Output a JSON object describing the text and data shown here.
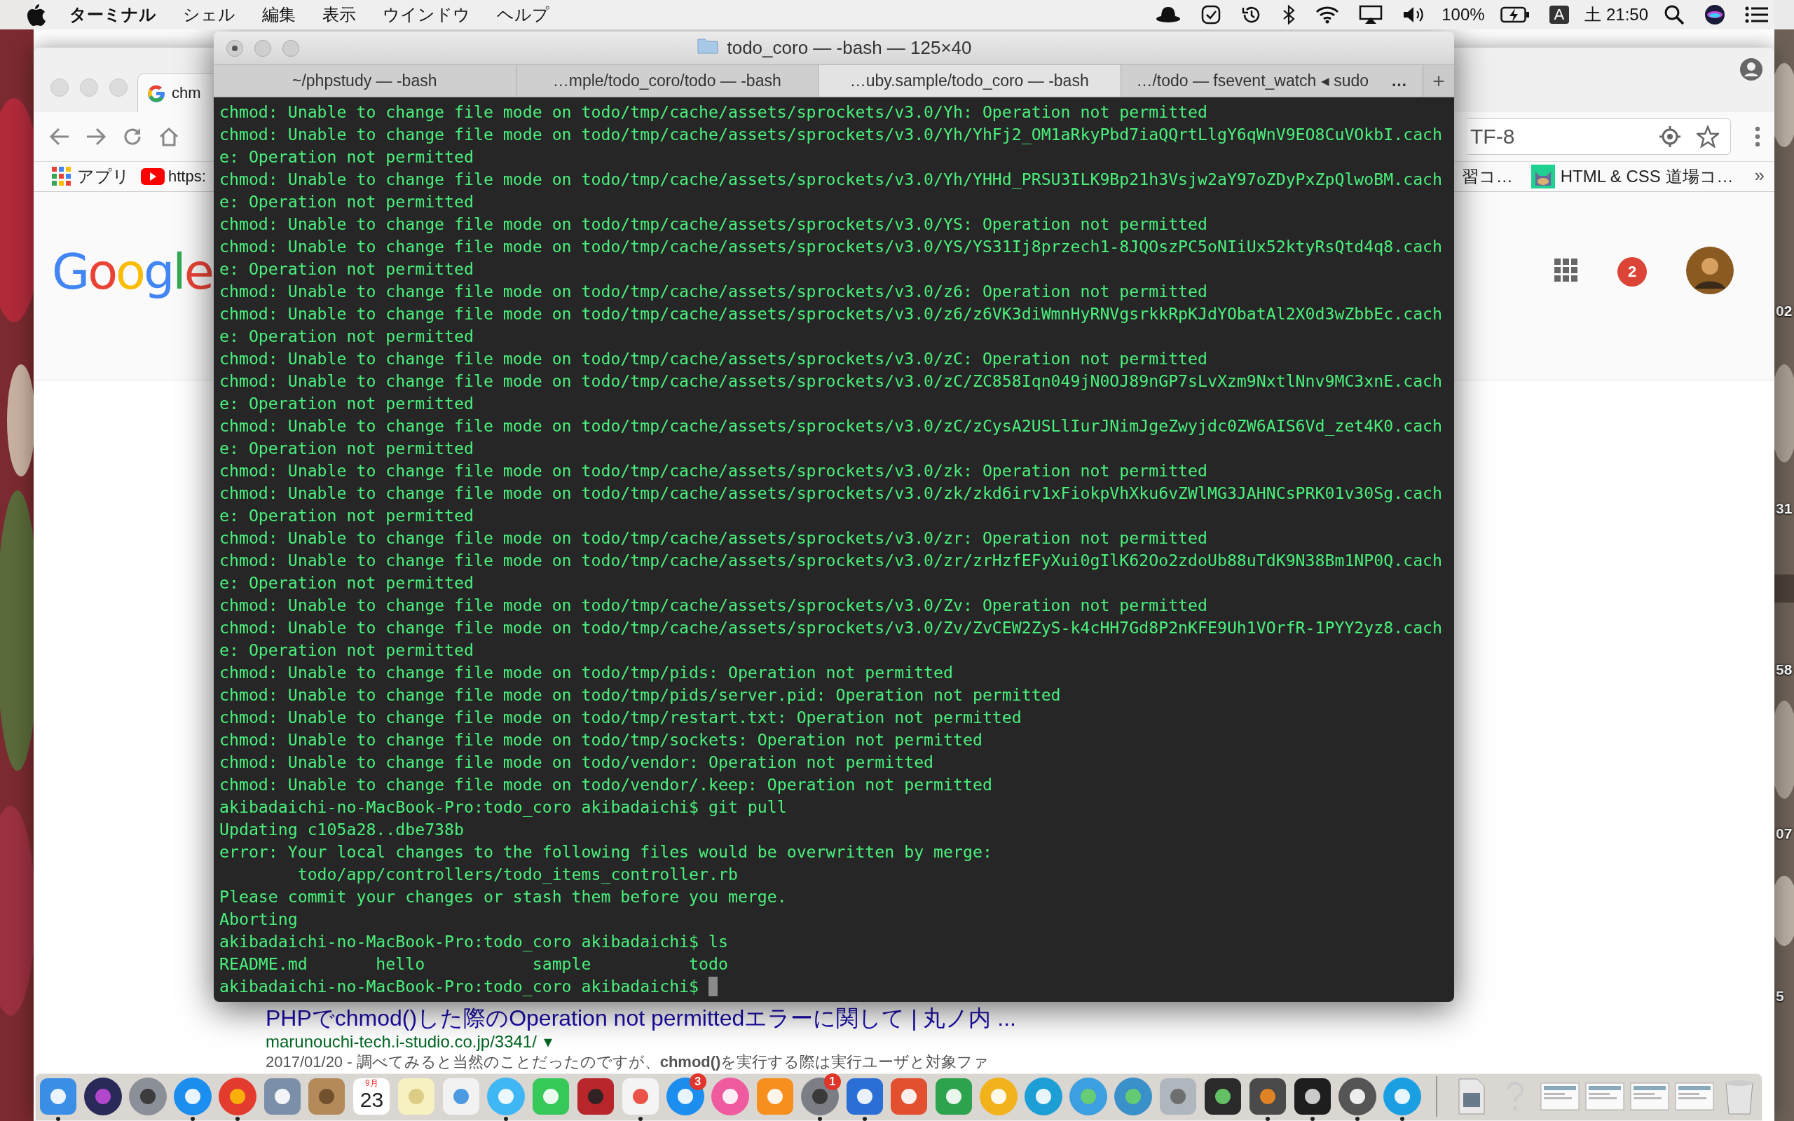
{
  "menu_bar": {
    "app_name": "ターミナル",
    "menus": [
      "シェル",
      "編集",
      "表示",
      "ウインドウ",
      "ヘルプ"
    ],
    "battery": "100%",
    "input_source": "A",
    "clock": "土 21:50"
  },
  "browser": {
    "tabs": [
      {
        "title": "chm",
        "selected": true
      }
    ],
    "address": "TF-8",
    "bookmarks_left": [
      {
        "label": "アプリ",
        "kind": "apps"
      },
      {
        "label": "https:",
        "kind": "video"
      }
    ],
    "bookmarks_right": [
      {
        "label": "習コ…",
        "kind": "plain"
      },
      {
        "label": "HTML & CSS 道場コ…",
        "kind": "cat"
      }
    ],
    "bookmarks_more": "»",
    "logo": "Google",
    "notification_count": "2",
    "result": {
      "title": "PHPでchmod()した際のOperation not permittedエラーに関して | 丸ノ内 ...",
      "url": "marunouchi-tech.i-studio.co.jp/3341/",
      "url_caret": "▾",
      "snippet": "2017/01/20 - 調べてみると当然のことだったのですが、**chmod()**を実行する際は実行ユーザと対象ファ"
    }
  },
  "terminal": {
    "title": "todo_coro — -bash — 125×40",
    "tabs": [
      {
        "label": "~/phpstudy — -bash",
        "selected": false
      },
      {
        "label": "…mple/todo_coro/todo — -bash",
        "selected": false
      },
      {
        "label": "…uby.sample/todo_coro — -bash",
        "selected": true
      },
      {
        "label": "…/todo — fsevent_watch ◂ sudo",
        "selected": false
      }
    ],
    "tabs_overflow": "…",
    "new_tab": "+",
    "lines": [
      "chmod: Unable to change file mode on todo/tmp/cache/assets/sprockets/v3.0/Yh: Operation not permitted",
      "chmod: Unable to change file mode on todo/tmp/cache/assets/sprockets/v3.0/Yh/YhFj2_OM1aRkyPbd7iaQQrtLlgY6qWnV9EO8CuVOkbI.cach",
      "e: Operation not permitted",
      "chmod: Unable to change file mode on todo/tmp/cache/assets/sprockets/v3.0/Yh/YHHd_PRSU3ILK9Bp21h3Vsjw2aY97oZDyPxZpQlwoBM.cach",
      "e: Operation not permitted",
      "chmod: Unable to change file mode on todo/tmp/cache/assets/sprockets/v3.0/YS: Operation not permitted",
      "chmod: Unable to change file mode on todo/tmp/cache/assets/sprockets/v3.0/YS/YS31Ij8przech1-8JQOszPC5oNIiUx52ktyRsQtd4q8.cach",
      "e: Operation not permitted",
      "chmod: Unable to change file mode on todo/tmp/cache/assets/sprockets/v3.0/z6: Operation not permitted",
      "chmod: Unable to change file mode on todo/tmp/cache/assets/sprockets/v3.0/z6/z6VK3diWmnHyRNVgsrkkRpKJdYObatAl2X0d3wZbbEc.cach",
      "e: Operation not permitted",
      "chmod: Unable to change file mode on todo/tmp/cache/assets/sprockets/v3.0/zC: Operation not permitted",
      "chmod: Unable to change file mode on todo/tmp/cache/assets/sprockets/v3.0/zC/ZC858Iqn049jN0OJ89nGP7sLvXzm9NxtlNnv9MC3xnE.cach",
      "e: Operation not permitted",
      "chmod: Unable to change file mode on todo/tmp/cache/assets/sprockets/v3.0/zC/zCysA2USLlIurJNimJgeZwyjdc0ZW6AIS6Vd_zet4K0.cach",
      "e: Operation not permitted",
      "chmod: Unable to change file mode on todo/tmp/cache/assets/sprockets/v3.0/zk: Operation not permitted",
      "chmod: Unable to change file mode on todo/tmp/cache/assets/sprockets/v3.0/zk/zkd6irv1xFiokpVhXku6vZWlMG3JAHNCsPRK01v30Sg.cach",
      "e: Operation not permitted",
      "chmod: Unable to change file mode on todo/tmp/cache/assets/sprockets/v3.0/zr: Operation not permitted",
      "chmod: Unable to change file mode on todo/tmp/cache/assets/sprockets/v3.0/zr/zrHzfEFyXui0gIlK62Oo2zdoUb88uTdK9N38Bm1NP0Q.cach",
      "e: Operation not permitted",
      "chmod: Unable to change file mode on todo/tmp/cache/assets/sprockets/v3.0/Zv: Operation not permitted",
      "chmod: Unable to change file mode on todo/tmp/cache/assets/sprockets/v3.0/Zv/ZvCEW2ZyS-k4cHH7Gd8P2nKFE9Uh1VOrfR-1PYY2yz8.cach",
      "e: Operation not permitted",
      "chmod: Unable to change file mode on todo/tmp/pids: Operation not permitted",
      "chmod: Unable to change file mode on todo/tmp/pids/server.pid: Operation not permitted",
      "chmod: Unable to change file mode on todo/tmp/restart.txt: Operation not permitted",
      "chmod: Unable to change file mode on todo/tmp/sockets: Operation not permitted",
      "chmod: Unable to change file mode on todo/vendor: Operation not permitted",
      "chmod: Unable to change file mode on todo/vendor/.keep: Operation not permitted",
      "akibadaichi-no-MacBook-Pro:todo_coro akibadaichi$ git pull",
      "Updating c105a28..dbe738b",
      "error: Your local changes to the following files would be overwritten by merge:",
      "        todo/app/controllers/todo_items_controller.rb",
      "Please commit your changes or stash them before you merge.",
      "Aborting",
      "akibadaichi-no-MacBook-Pro:todo_coro akibadaichi$ ls",
      "README.md       hello           sample          todo",
      "akibadaichi-no-MacBook-Pro:todo_coro akibadaichi$ "
    ]
  },
  "dock": {
    "items": [
      {
        "kind": "app",
        "running": true
      },
      {
        "kind": "app",
        "running": false
      },
      {
        "kind": "app",
        "running": false
      },
      {
        "kind": "app",
        "running": true
      },
      {
        "kind": "app",
        "running": true
      },
      {
        "kind": "app",
        "running": false
      },
      {
        "kind": "app",
        "running": false
      },
      {
        "kind": "calendar",
        "month": "9月",
        "day": "23",
        "running": false
      },
      {
        "kind": "app",
        "running": false
      },
      {
        "kind": "app",
        "running": false
      },
      {
        "kind": "app",
        "running": true
      },
      {
        "kind": "app",
        "running": false
      },
      {
        "kind": "app",
        "running": false
      },
      {
        "kind": "app",
        "running": true
      },
      {
        "kind": "app",
        "badge": "3",
        "running": false
      },
      {
        "kind": "app",
        "running": false
      },
      {
        "kind": "app",
        "running": false
      },
      {
        "kind": "app",
        "badge": "1",
        "running": true
      },
      {
        "kind": "app",
        "running": true
      },
      {
        "kind": "app",
        "running": false
      },
      {
        "kind": "app",
        "running": false
      },
      {
        "kind": "app",
        "running": false
      },
      {
        "kind": "app",
        "running": false
      },
      {
        "kind": "app",
        "running": false
      },
      {
        "kind": "app",
        "running": false
      },
      {
        "kind": "app",
        "running": false
      },
      {
        "kind": "app",
        "running": false
      },
      {
        "kind": "app",
        "running": true
      },
      {
        "kind": "app",
        "running": true
      },
      {
        "kind": "app",
        "running": true
      },
      {
        "kind": "app",
        "running": true
      },
      {
        "kind": "separator"
      },
      {
        "kind": "document"
      },
      {
        "kind": "unknown_app"
      },
      {
        "kind": "thumbnail"
      },
      {
        "kind": "thumbnail"
      },
      {
        "kind": "thumbnail"
      },
      {
        "kind": "thumbnail"
      },
      {
        "kind": "trash"
      }
    ]
  },
  "desktop_labels": [
    "02",
    "31",
    "58",
    "07",
    "5"
  ]
}
